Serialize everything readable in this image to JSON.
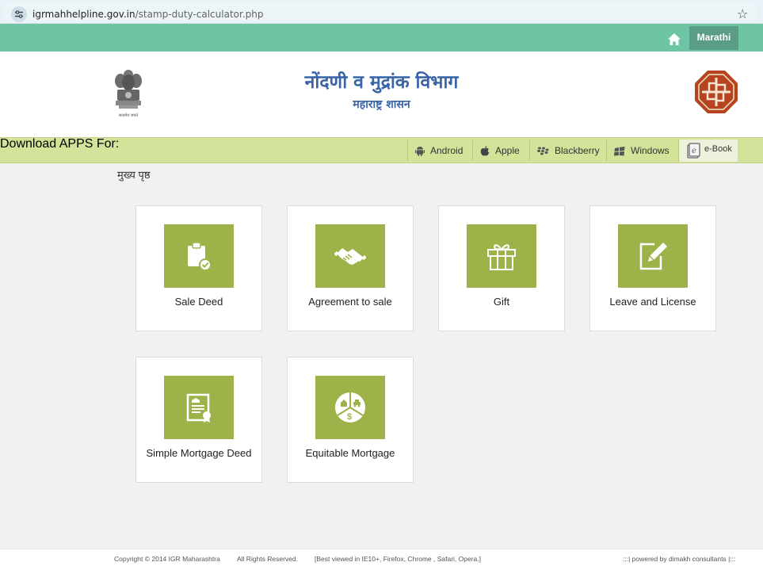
{
  "browser": {
    "url_host": "igrmahhelpline.gov.in",
    "url_path": "/stamp-duty-calculator.php"
  },
  "topnav": {
    "language_button": "Marathi"
  },
  "header": {
    "title": "नोंदणी व मुद्रांक विभाग",
    "subtitle": "महाराष्ट्र शासन",
    "emblem_caption": "सत्यमेव जयते"
  },
  "appbar": {
    "download_label": "Download APPS For:",
    "apps": [
      "Android",
      "Apple",
      "Blackberry",
      "Windows"
    ],
    "ebook": "e-Book"
  },
  "breadcrumb": "मुख्य पृष्ठ",
  "cards": [
    {
      "label": "Sale Deed",
      "icon": "clipboard-check-icon"
    },
    {
      "label": "Agreement to sale",
      "icon": "handshake-icon"
    },
    {
      "label": "Gift",
      "icon": "gift-icon"
    },
    {
      "label": "Leave and License",
      "icon": "edit-document-icon"
    },
    {
      "label": "Simple Mortgage Deed",
      "icon": "certificate-icon"
    },
    {
      "label": "Equitable Mortgage",
      "icon": "mortgage-pie-icon"
    }
  ],
  "footer": {
    "copyright": "Copyright © 2014 IGR Maharashtra",
    "rights": "All Rights Reserved.",
    "best_viewed": "[Best viewed in IE10+, Firefox, Chrome , Safari, Opera.]",
    "powered": ":::| powered by dimakh consultants |:::"
  },
  "colors": {
    "topnav": "#6ec5a4",
    "appbar": "#d3e39a",
    "tile": "#9db34a",
    "title_blue": "#3a63a8"
  }
}
